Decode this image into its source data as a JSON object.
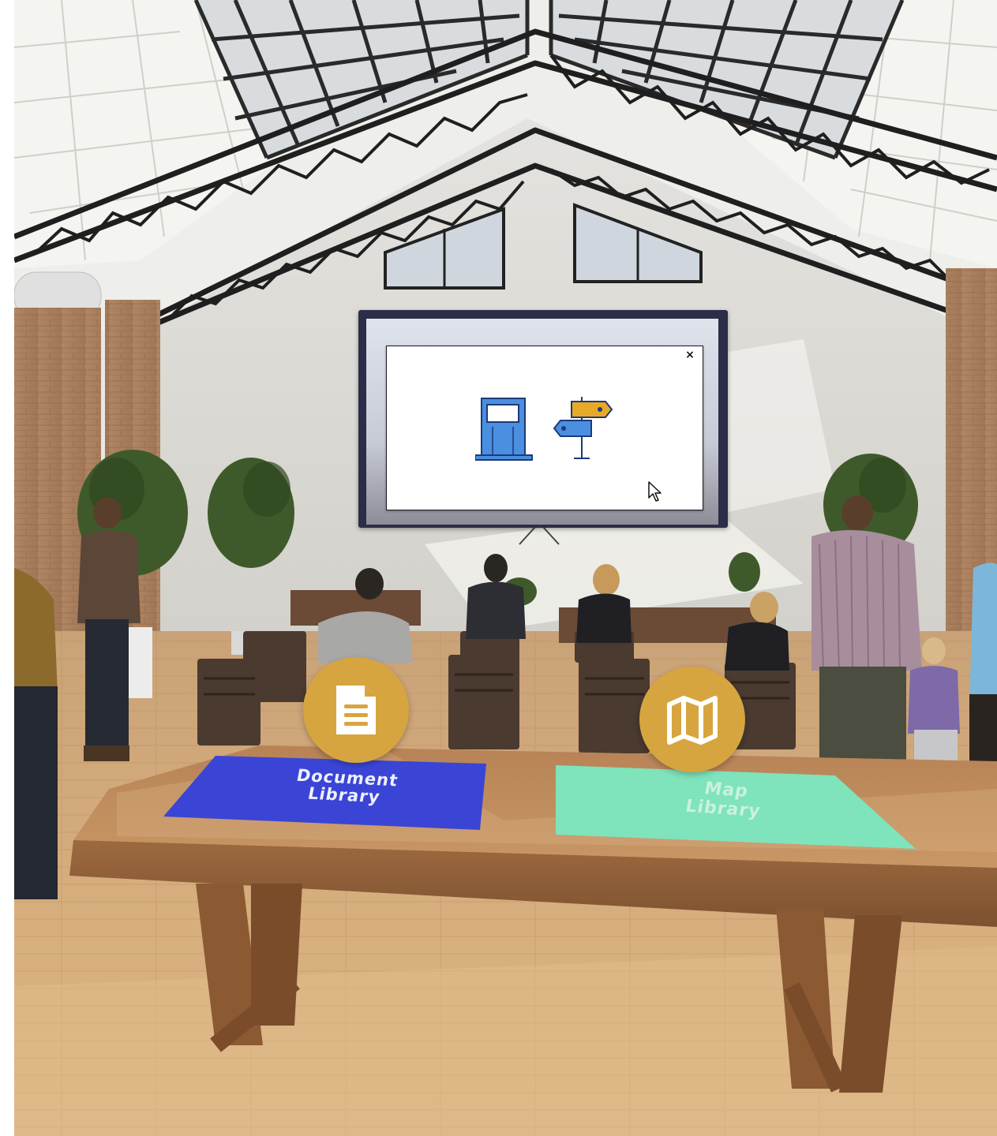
{
  "scene": {
    "hotspots": [
      {
        "label": "Document Library",
        "line1": "Document",
        "line2": "Library",
        "icon": "document-icon",
        "sign_color": "#3a45d6"
      },
      {
        "label": "Map Library",
        "line1": "Map",
        "line2": "Library",
        "icon": "map-icon",
        "sign_color": "#7fe3bc"
      }
    ],
    "screen": {
      "modal_close_glyph": "×",
      "modal_illustration": "kiosk-and-signpost-icon"
    },
    "colors": {
      "hotspot_gold": "#d7a53f",
      "doc_sign_blue": "#3a45d6",
      "map_sign_mint": "#7fe3bc",
      "kiosk_blue": "#4a8fe0",
      "signpost_orange": "#e8a928"
    }
  }
}
